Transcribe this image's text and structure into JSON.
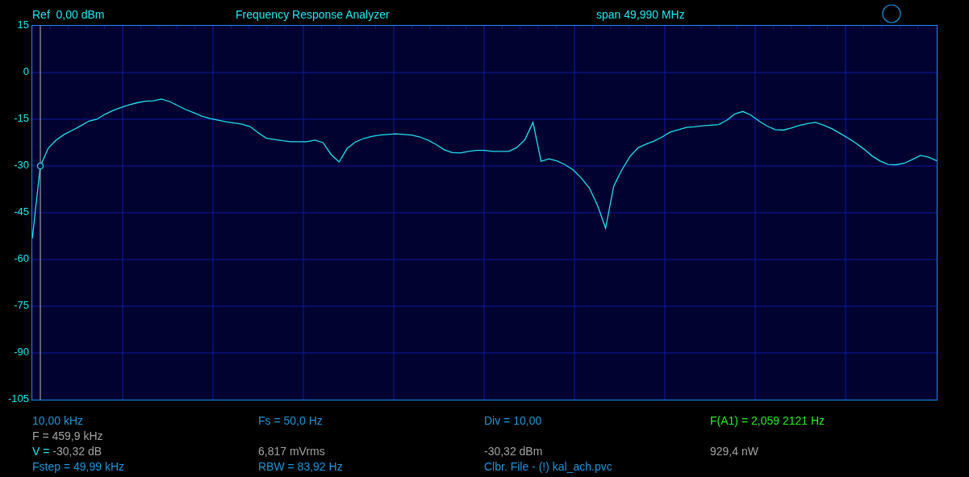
{
  "header": {
    "reference": "Ref  0,00 dBm",
    "title": "Frequency Response Analyzer",
    "span": "span 49,990 MHz"
  },
  "chart_data": {
    "type": "line",
    "grid": true,
    "ylim": [
      -105,
      15
    ],
    "yticks": [
      15,
      0,
      -15,
      -30,
      -45,
      -60,
      -75,
      -90,
      -105
    ],
    "categories": [
      null,
      null,
      null,
      null,
      null,
      null,
      null,
      null,
      null,
      null,
      null,
      null,
      null,
      null,
      null,
      null,
      null,
      null,
      null,
      null,
      null,
      null,
      null,
      null,
      null,
      null,
      null,
      null,
      null,
      null,
      null,
      null,
      null,
      null,
      null,
      null,
      null,
      null,
      null,
      null,
      null,
      null,
      null,
      null,
      null,
      null,
      null,
      null,
      null,
      null,
      null,
      null,
      null,
      null,
      null,
      null,
      null,
      null,
      null,
      null,
      null,
      null,
      null,
      null,
      null,
      null,
      null,
      null,
      null,
      null,
      null,
      null,
      null,
      null,
      null,
      null,
      null,
      null,
      null,
      null,
      null,
      null,
      null,
      null,
      null,
      null,
      null,
      null,
      null,
      null,
      null,
      null,
      null,
      null,
      null,
      null,
      null,
      null,
      null,
      null,
      null,
      null,
      null,
      null,
      null,
      null,
      null,
      null,
      null,
      null,
      null,
      null,
      null
    ],
    "series": [
      {
        "color": "#22e0f0",
        "values": [
          -53.3,
          -30.0,
          -24.2,
          -21.6,
          -19.8,
          -18.5,
          -17.1,
          -15.6,
          -15.0,
          -13.4,
          -12.2,
          -11.2,
          -10.4,
          -9.7,
          -9.2,
          -9.1,
          -8.5,
          -9.3,
          -10.6,
          -11.9,
          -12.9,
          -14.0,
          -14.8,
          -15.3,
          -15.8,
          -16.2,
          -16.6,
          -17.4,
          -19.4,
          -21.1,
          -21.5,
          -21.9,
          -22.2,
          -22.2,
          -22.2,
          -21.7,
          -22.5,
          -26.3,
          -28.7,
          -24.4,
          -22.3,
          -21.2,
          -20.5,
          -20.1,
          -19.9,
          -19.7,
          -19.9,
          -20.1,
          -20.7,
          -21.7,
          -23.1,
          -24.8,
          -25.7,
          -25.8,
          -25.3,
          -25.0,
          -25.0,
          -25.3,
          -25.3,
          -25.3,
          -24.1,
          -21.6,
          -16.0,
          -28.5,
          -27.7,
          -28.4,
          -29.6,
          -31.3,
          -33.9,
          -37.1,
          -42.7,
          -50.0,
          -36.5,
          -31.3,
          -27.0,
          -24.2,
          -23.0,
          -22.0,
          -20.7,
          -19.1,
          -18.4,
          -17.6,
          -17.4,
          -17.1,
          -16.9,
          -16.7,
          -15.3,
          -13.3,
          -12.5,
          -13.7,
          -15.6,
          -17.2,
          -18.3,
          -18.5,
          -17.8,
          -17.0,
          -16.4,
          -16.0,
          -16.9,
          -18.0,
          -19.5,
          -21.0,
          -22.7,
          -24.6,
          -26.8,
          -28.4,
          -29.5,
          -29.6,
          -29.1,
          -27.9,
          -26.6,
          -27.2,
          -28.3
        ]
      }
    ]
  },
  "info_rows": [
    [
      {
        "kind": "setting",
        "text": "10,00 kHz"
      },
      {
        "kind": "setting",
        "text": "Fs = 50,0 Hz"
      },
      {
        "kind": "setting",
        "text": "Div = 10,00"
      },
      {
        "kind": "marker",
        "text": "F(A1) = 2,059 2121 Hz"
      }
    ],
    [
      {
        "kind": "reading",
        "text": "F = 459,9 kHz"
      },
      null,
      null,
      null
    ],
    [
      {
        "kind": "labeled",
        "label": "V =",
        "text": "-30,32 dB"
      },
      {
        "kind": "reading",
        "text": "6,817 mVrms"
      },
      {
        "kind": "reading",
        "text": "-30,32 dBm"
      },
      {
        "kind": "reading",
        "text": "929,4 nW"
      }
    ],
    [
      {
        "kind": "setting",
        "text": "Fstep = 49,99 kHz"
      },
      {
        "kind": "setting",
        "text": "RBW = 83,92 Hz"
      },
      {
        "kind": "setting",
        "text": "Clbr. File - (!) kal_ach.pvc"
      },
      null
    ]
  ]
}
